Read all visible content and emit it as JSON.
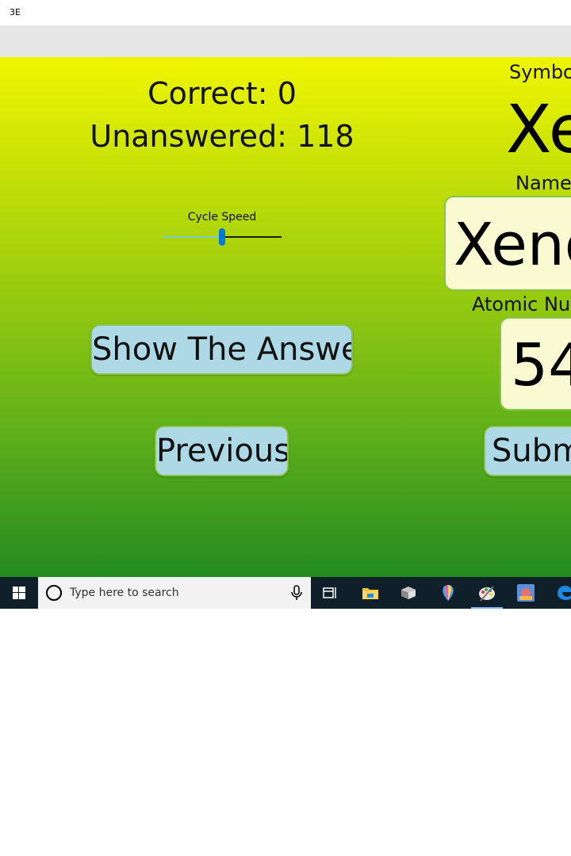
{
  "window": {
    "title": "3E"
  },
  "stats": {
    "correct": "Correct: 0",
    "unanswered": "Unanswered: 118"
  },
  "slider": {
    "label": "Cycle Speed",
    "value_fraction": 0.5
  },
  "buttons": {
    "show_answer": "Show The Answer",
    "previous": "Previous",
    "submit": "Subm"
  },
  "element": {
    "symbol_label": "Symbol",
    "symbol": "Xe",
    "name_label": "Name",
    "name_value": "Xeno",
    "atomic_label": "Atomic Nur",
    "atomic_value": "54"
  },
  "taskbar": {
    "search_placeholder": "Type here to search",
    "icons": [
      "windows-start-icon",
      "task-view-icon",
      "file-explorer-icon",
      "3d-viewer-icon",
      "paint-3d-icon",
      "paint-palette-icon",
      "game-app-icon",
      "edge-browser-icon"
    ]
  },
  "colors": {
    "gradient_top": "#f0f500",
    "gradient_bottom": "#238b20",
    "button_fill": "#add8e6",
    "field_fill": "#fafad2",
    "accent": "#0078d7"
  }
}
